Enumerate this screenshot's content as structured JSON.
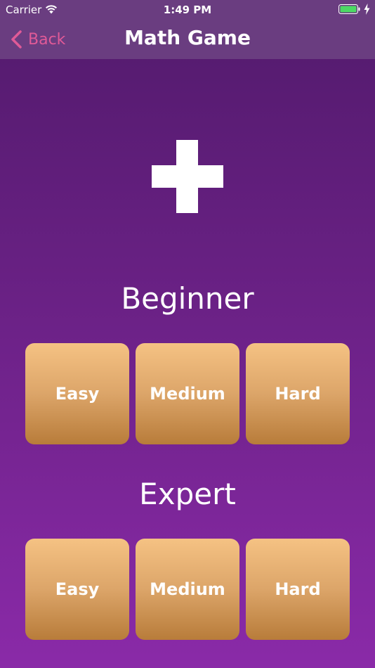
{
  "status_bar": {
    "carrier": "Carrier",
    "time": "1:49 PM",
    "battery_color": "#4cd964"
  },
  "nav_bar": {
    "back_label": "Back",
    "title": "Math Game",
    "tint_color": "#e05a97"
  },
  "operation_icon": "plus-icon",
  "sections": [
    {
      "title": "Beginner",
      "levels": [
        "Easy",
        "Medium",
        "Hard"
      ]
    },
    {
      "title": "Expert",
      "levels": [
        "Easy",
        "Medium",
        "Hard"
      ]
    }
  ],
  "colors": {
    "background_top": "#521a6c",
    "background_bottom": "#8a2aa8",
    "bar_background": "#6a3d80",
    "tile_top": "#f5c283",
    "tile_bottom": "#b87c3a"
  }
}
